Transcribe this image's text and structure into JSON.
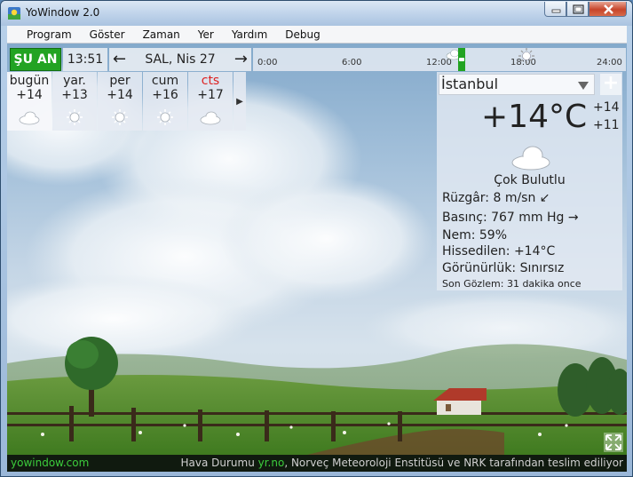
{
  "window": {
    "title": "YoWindow 2.0"
  },
  "menu": [
    "Program",
    "Göster",
    "Zaman",
    "Yer",
    "Yardım",
    "Debug"
  ],
  "topbar": {
    "now_label": "ŞU AN",
    "time": "13:51",
    "date": "SAL, Nis 27",
    "prev_arrow": "←",
    "next_arrow": "→",
    "timeline_labels": [
      "0:00",
      "6:00",
      "12:00",
      "18:00",
      "24:00"
    ]
  },
  "forecast": [
    {
      "day": "bugün",
      "temp": "+14",
      "icon": "cloud-icon",
      "weekend": false
    },
    {
      "day": "yar.",
      "temp": "+13",
      "icon": "sun-icon",
      "weekend": false
    },
    {
      "day": "per",
      "temp": "+14",
      "icon": "sun-icon",
      "weekend": false
    },
    {
      "day": "cum",
      "temp": "+16",
      "icon": "sun-icon",
      "weekend": false
    },
    {
      "day": "cts",
      "temp": "+17",
      "icon": "cloud-icon",
      "weekend": true
    }
  ],
  "forecast_more": "▶",
  "panel": {
    "city": "İstanbul",
    "add": "+",
    "temperature": "+14°C",
    "high": "+14",
    "low": "+11",
    "condition": "Çok Bulutlu",
    "wind": "Rüzgâr:  8 m/sn ↙",
    "pressure": "Basınç:  767 mm Hg →",
    "humidity": "Nem:  59%",
    "feels_like": "Hissedilen:  +14°C",
    "visibility": "Görünürlük:  Sınırsız",
    "last_observation": "Son Gözlem:  31 dakika once"
  },
  "status": {
    "site": "yowindow.com",
    "prefix": "Hava Durumu ",
    "source_link": "yr.no",
    "suffix": ", Norveç Meteoroloji Enstitüsü ve NRK tarafından teslim ediliyor"
  },
  "colors": {
    "accent_green": "#22a322",
    "weekend_red": "#dd2222",
    "status_bg": "#101a0f"
  }
}
